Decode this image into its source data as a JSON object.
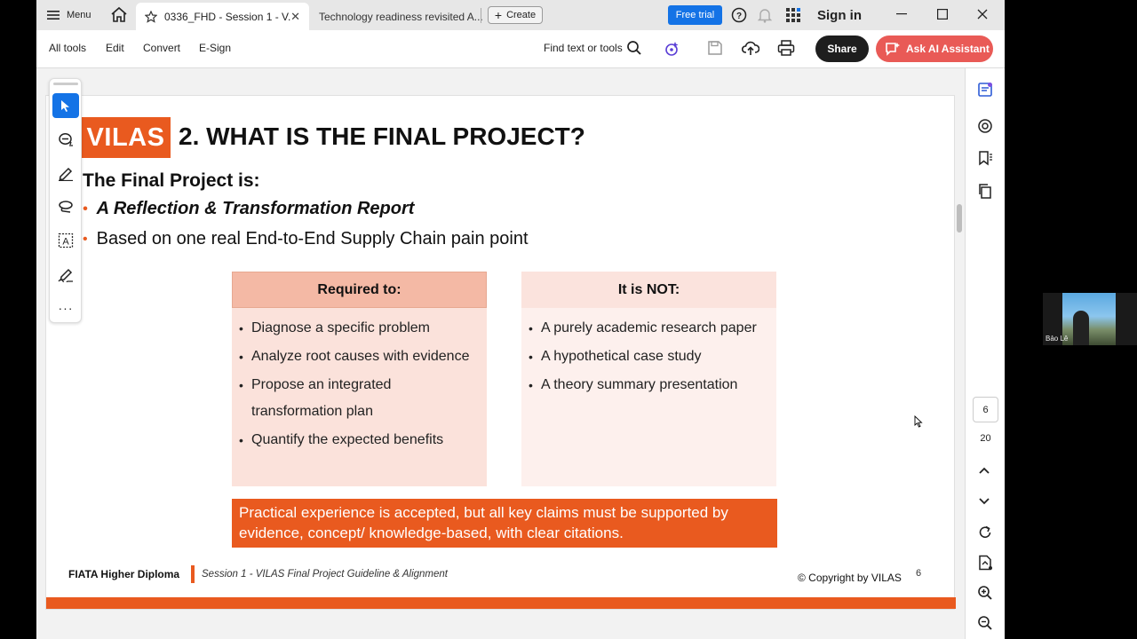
{
  "titlebar": {
    "menu_label": "Menu",
    "tabs": [
      {
        "title": "0336_FHD - Session 1 - V...",
        "active": true
      },
      {
        "title": "Technology readiness revisited A...",
        "active": false
      }
    ],
    "create_label": "Create",
    "free_trial_label": "Free trial",
    "signin_label": "Sign in"
  },
  "toolbar": {
    "menus": [
      "All tools",
      "Edit",
      "Convert",
      "E-Sign"
    ],
    "find_label": "Find text or tools",
    "share_label": "Share",
    "ai_label": "Ask AI Assistant"
  },
  "slide": {
    "logo": "VILAS",
    "title": "2. WHAT IS THE FINAL PROJECT?",
    "subhead": "The Final Project is:",
    "bullets": [
      "A Reflection & Transformation Report",
      "Based on one real End-to-End Supply Chain pain point"
    ],
    "required": {
      "heading": "Required to:",
      "items": [
        "Diagnose a specific problem",
        "Analyze root causes with evidence",
        "Propose an integrated transformation plan",
        "Quantify the expected benefits"
      ]
    },
    "not": {
      "heading": "It is NOT:",
      "items": [
        "A purely academic research paper",
        "A hypothetical case study",
        "A theory summary presentation"
      ]
    },
    "callout": "Practical experience is accepted, but all key claims must be supported by evidence, concept/ knowledge-based, with clear citations.",
    "footer": {
      "program": "FIATA Higher Diploma",
      "session": "Session 1 - VILAS Final Project Guideline & Alignment",
      "copyright": "© Copyright by VILAS",
      "page_number": "6"
    }
  },
  "rightrail": {
    "current_page": "6",
    "total_pages": "20"
  },
  "video": {
    "participant_name": "Bảo Lê"
  },
  "colors": {
    "accent_orange": "#e95a1f",
    "primary_blue": "#1473e6",
    "ai_button": "#e95a56"
  }
}
